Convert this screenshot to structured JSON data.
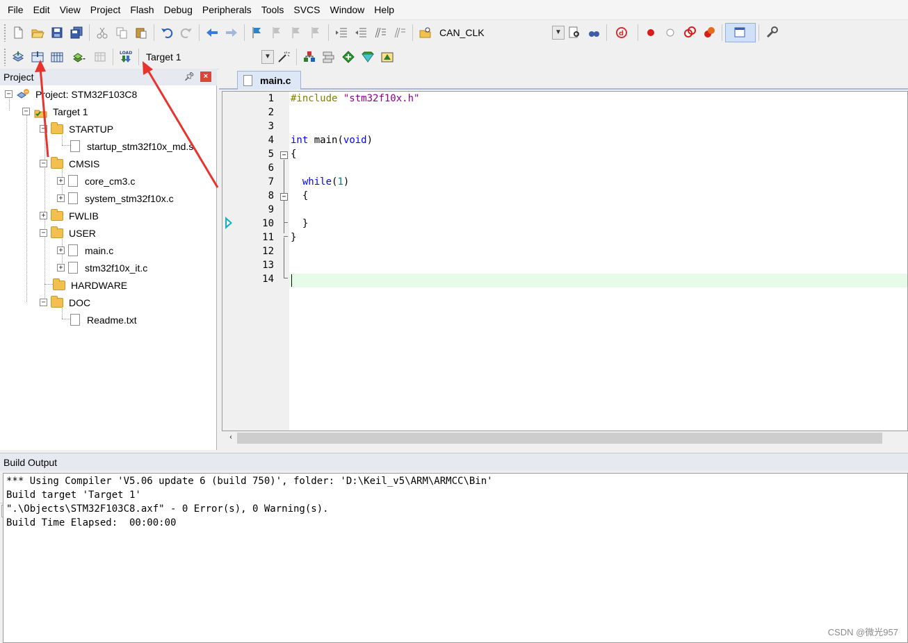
{
  "menu": [
    "File",
    "Edit",
    "View",
    "Project",
    "Flash",
    "Debug",
    "Peripherals",
    "Tools",
    "SVCS",
    "Window",
    "Help"
  ],
  "menu_underline": [
    "F",
    "E",
    "V",
    "P",
    "a",
    "D",
    "r",
    "T",
    "S",
    "W",
    "H"
  ],
  "toolbar1": {
    "find_combo_value": "CAN_CLK",
    "icons": [
      "new-file-icon",
      "open-file-icon",
      "save-icon",
      "save-all-icon",
      "cut-icon",
      "copy-icon",
      "paste-icon",
      "undo-icon",
      "redo-icon",
      "nav-back-icon",
      "nav-forward-icon",
      "bookmark-icon",
      "prev-bookmark-icon",
      "next-bookmark-icon",
      "clear-bookmarks-icon",
      "indent-icon",
      "unindent-icon",
      "comment-icon",
      "uncomment-icon",
      "find-in-files-icon",
      "find-icon",
      "incremental-find-icon",
      "debug-session-icon",
      "breakpoint-icon",
      "disable-breakpoint-icon",
      "disable-all-breakpoints-icon",
      "kill-all-breakpoints-icon",
      "window-select-icon",
      "configure-icon"
    ]
  },
  "toolbar2": {
    "target_value": "Target 1",
    "load_label": "LOAD"
  },
  "project_panel": {
    "title": "Project",
    "tree": [
      {
        "label": "Project: STM32F103C8",
        "depth": 0,
        "kind": "project",
        "expander": "⊟"
      },
      {
        "label": "Target 1",
        "depth": 1,
        "kind": "target",
        "expander": "⊟"
      },
      {
        "label": "STARTUP",
        "depth": 2,
        "kind": "folder",
        "expander": "⊟"
      },
      {
        "label": "startup_stm32f10x_md.s",
        "depth": 3,
        "kind": "file",
        "expander": ""
      },
      {
        "label": "CMSIS",
        "depth": 2,
        "kind": "folder",
        "expander": "⊟"
      },
      {
        "label": "core_cm3.c",
        "depth": 3,
        "kind": "file",
        "expander": "⊞"
      },
      {
        "label": "system_stm32f10x.c",
        "depth": 3,
        "kind": "file",
        "expander": "⊞"
      },
      {
        "label": "FWLIB",
        "depth": 2,
        "kind": "folder",
        "expander": "⊞"
      },
      {
        "label": "USER",
        "depth": 2,
        "kind": "folder",
        "expander": "⊟"
      },
      {
        "label": "main.c",
        "depth": 3,
        "kind": "file",
        "expander": "⊞"
      },
      {
        "label": "stm32f10x_it.c",
        "depth": 3,
        "kind": "file",
        "expander": "⊞"
      },
      {
        "label": "HARDWARE",
        "depth": 2,
        "kind": "folder",
        "expander": ""
      },
      {
        "label": "DOC",
        "depth": 2,
        "kind": "folder",
        "expander": "⊟"
      },
      {
        "label": "Readme.txt",
        "depth": 3,
        "kind": "file",
        "expander": ""
      }
    ]
  },
  "editor": {
    "tab_label": "main.c",
    "line_numbers": [
      "1",
      "2",
      "3",
      "4",
      "5",
      "6",
      "7",
      "8",
      "9",
      "10",
      "11",
      "12",
      "13",
      "14"
    ],
    "lines": {
      "l1_pp": "#include",
      "l1_str": "\"stm32f10x.h\"",
      "l4_kw1": "int",
      "l4_mid": "main(",
      "l4_kw2": "void",
      "l4_end": ")",
      "l5": "{",
      "l7_kw": "while",
      "l7_open": "(",
      "l7_num": "1",
      "l7_close": ")",
      "l8": "{",
      "l10": "}",
      "l11": "}"
    },
    "current_line": "14"
  },
  "build_output": {
    "title": "Build Output",
    "lines": [
      "*** Using Compiler 'V5.06 update 6 (build 750)', folder: 'D:\\Keil_v5\\ARM\\ARMCC\\Bin'",
      "Build target 'Target 1'",
      "\".\\Objects\\STM32F103C8.axf\" - 0 Error(s), 0 Warning(s).",
      "Build Time Elapsed:  00:00:00"
    ]
  },
  "watermark": "CSDN @微光957",
  "colors": {
    "annotation_arrow": "#e8322c",
    "keyword": "#0000ff",
    "preprocessor": "#7f7f00",
    "string": "#8b008b",
    "number": "#008080",
    "current_line_bg": "#e6fbe8",
    "exec_arrow": "#19b0c4"
  }
}
